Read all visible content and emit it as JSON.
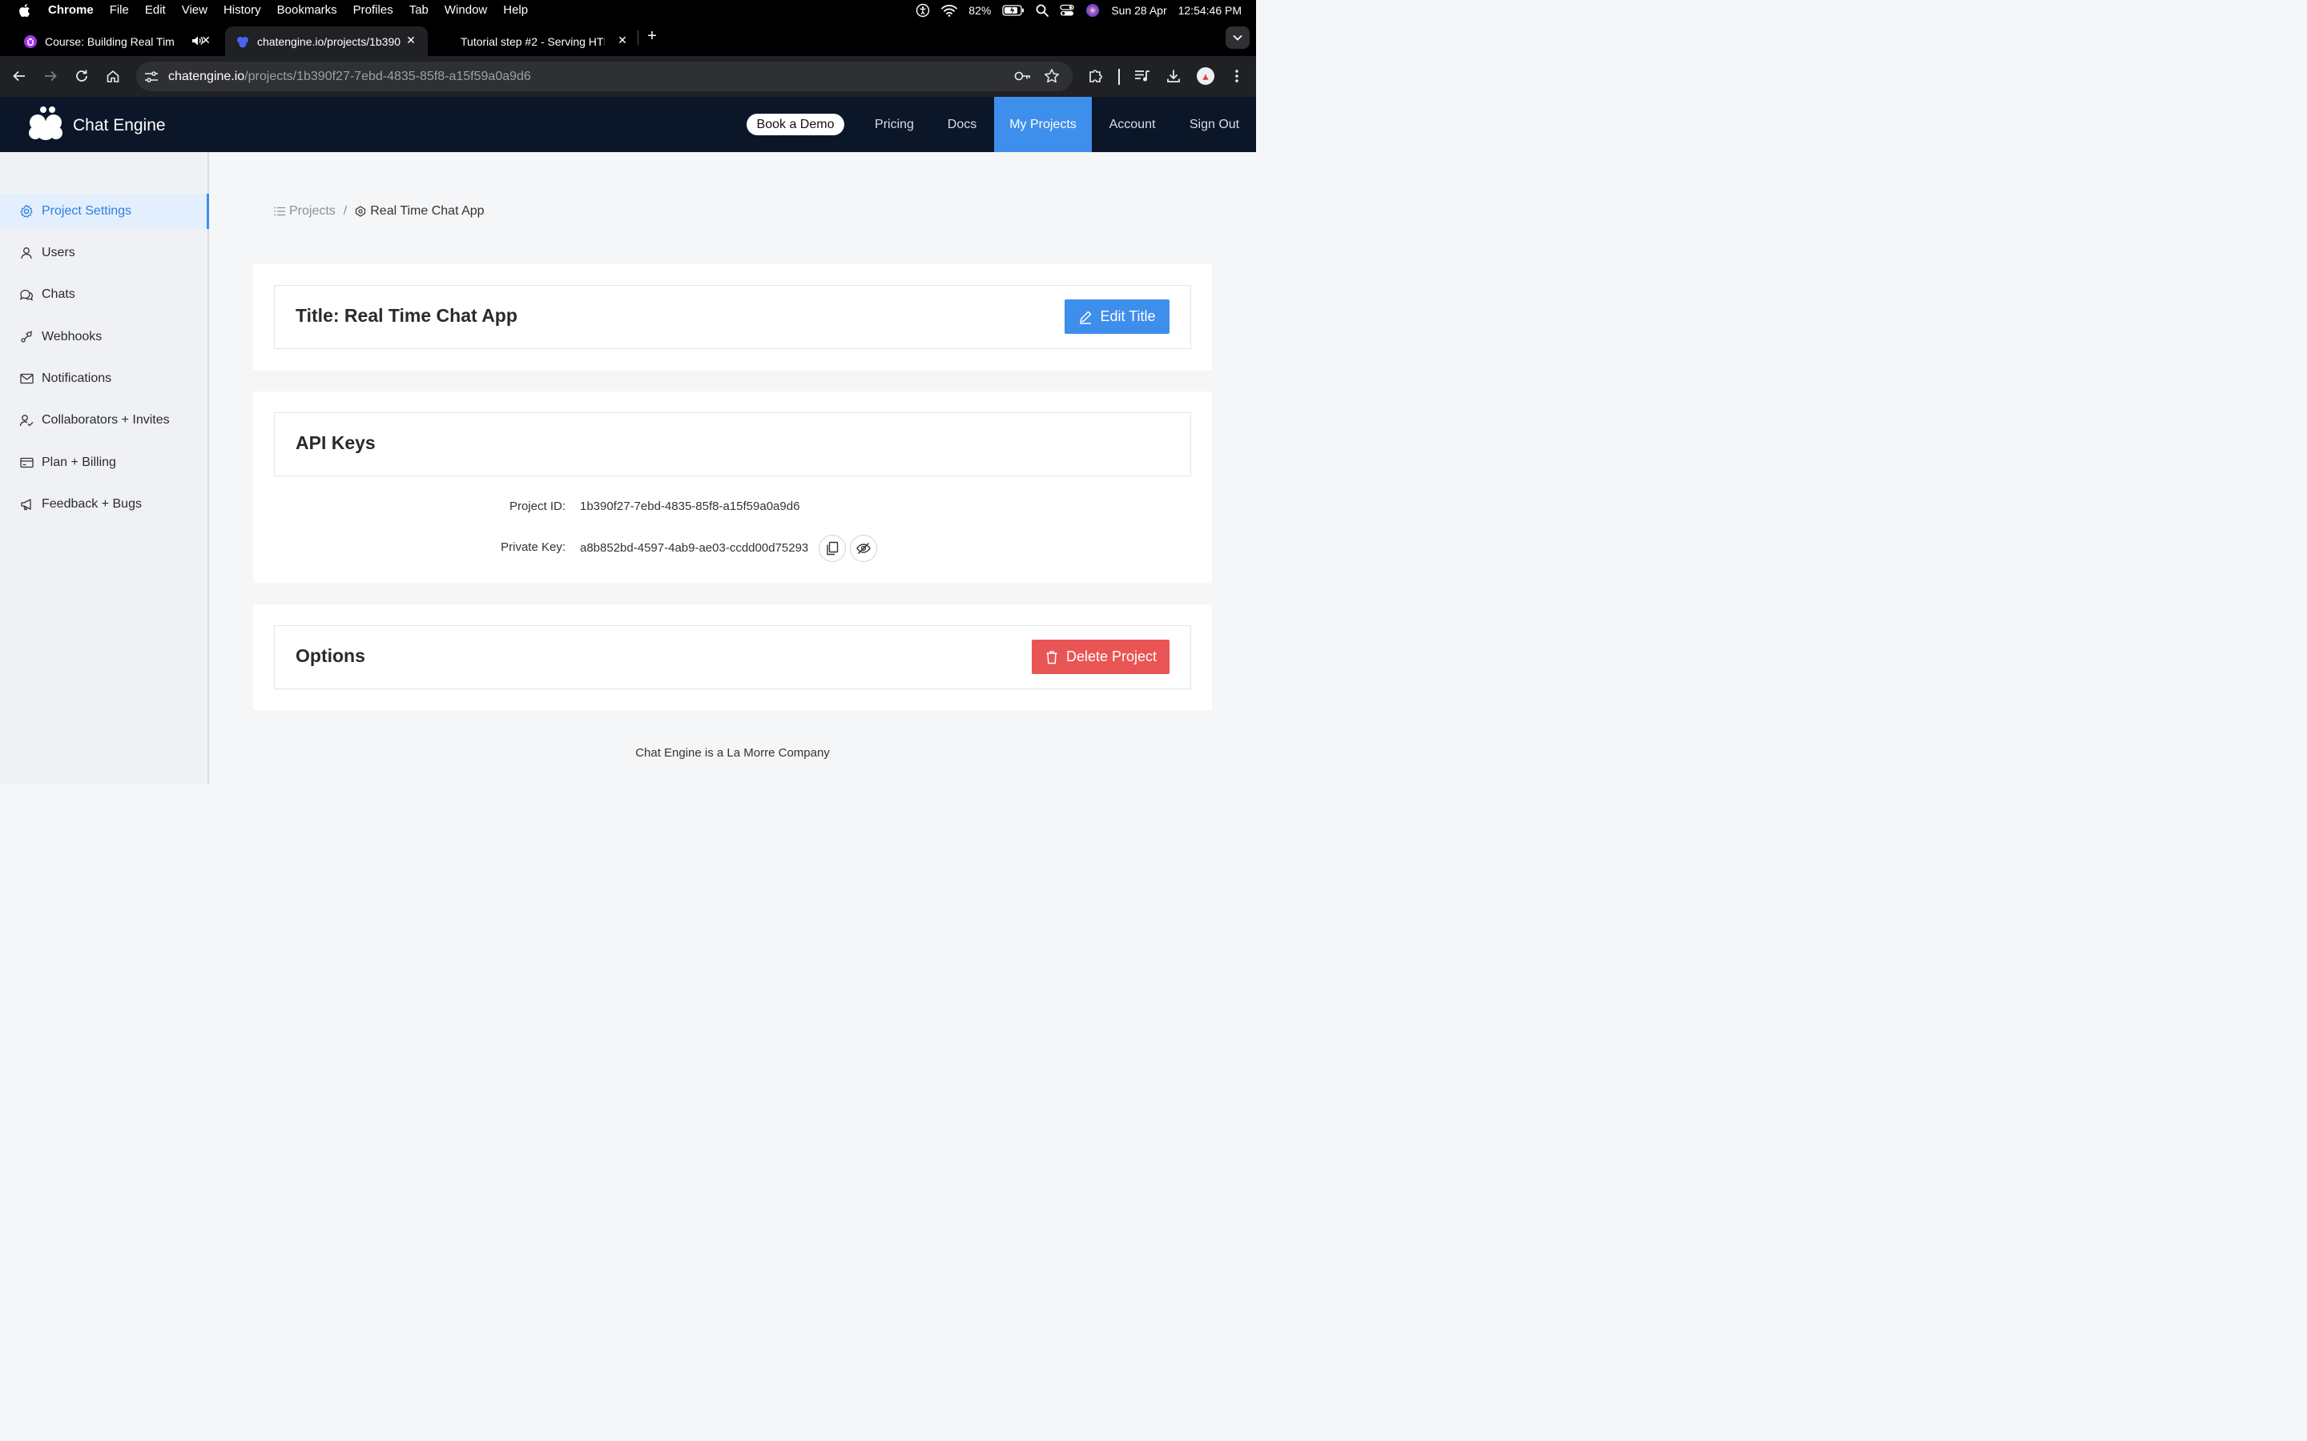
{
  "menubar": {
    "items": [
      "Chrome",
      "File",
      "Edit",
      "View",
      "History",
      "Bookmarks",
      "Profiles",
      "Tab",
      "Window",
      "Help"
    ],
    "battery": "82%",
    "date": "Sun 28 Apr",
    "time": "12:54:46 PM"
  },
  "tabs": [
    {
      "title": "Course: Building Real Tim",
      "favicon_color": "#a435f0"
    },
    {
      "title": "chatengine.io/projects/1b390",
      "favicon_color": "#4a63f0"
    },
    {
      "title": "Tutorial step #2 - Serving HTI",
      "favicon_color": ""
    }
  ],
  "address_bar": {
    "domain": "chatengine.io",
    "path": "/projects/1b390f27-7ebd-4835-85f8-a15f59a0a9d6"
  },
  "header": {
    "brand": "Chat Engine",
    "book_demo": "Book a Demo",
    "nav": [
      "Pricing",
      "Docs",
      "My Projects",
      "Account",
      "Sign Out"
    ]
  },
  "sidebar": {
    "items": [
      {
        "label": "Project Settings",
        "icon": "gear-icon"
      },
      {
        "label": "Users",
        "icon": "user-icon"
      },
      {
        "label": "Chats",
        "icon": "chat-icon"
      },
      {
        "label": "Webhooks",
        "icon": "webhook-icon"
      },
      {
        "label": "Notifications",
        "icon": "mail-icon"
      },
      {
        "label": "Collaborators + Invites",
        "icon": "collaborators-icon"
      },
      {
        "label": "Plan + Billing",
        "icon": "card-icon"
      },
      {
        "label": "Feedback + Bugs",
        "icon": "megaphone-icon"
      }
    ]
  },
  "breadcrumb": {
    "projects": "Projects",
    "separator": "/",
    "current": "Real Time Chat App"
  },
  "title_section": {
    "heading": "Title: Real Time Chat App",
    "edit_button": "Edit Title"
  },
  "api_keys": {
    "heading": "API Keys",
    "project_id_label": "Project ID:",
    "project_id": "1b390f27-7ebd-4835-85f8-a15f59a0a9d6",
    "private_key_label": "Private Key:",
    "private_key": "a8b852bd-4597-4ab9-ae03-ccdd00d75293"
  },
  "options": {
    "heading": "Options",
    "delete_button": "Delete Project"
  },
  "footer": "Chat Engine is a La Morre Company",
  "colors": {
    "accent": "#3e8eec",
    "danger": "#e95454",
    "header_bg": "#0b1729"
  }
}
